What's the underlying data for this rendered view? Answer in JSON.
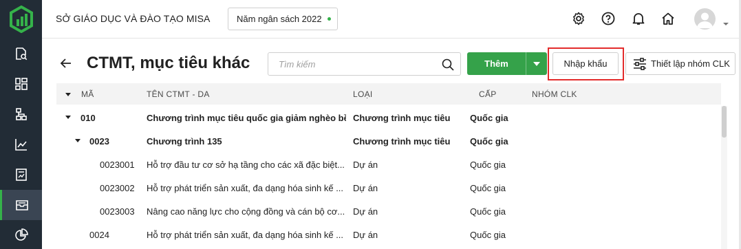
{
  "app": {
    "org_name": "SỞ GIÁO DỤC VÀ ĐÀO TẠO MISA",
    "budget_year": "Năm ngân sách 2022",
    "accent_color": "#35a24a",
    "nav_bg": "#222c36"
  },
  "sidebar": {
    "items": [
      {
        "icon": "doc-search-icon"
      },
      {
        "icon": "dashboard-icon"
      },
      {
        "icon": "org-chart-icon"
      },
      {
        "icon": "line-chart-icon"
      },
      {
        "icon": "report-icon"
      },
      {
        "icon": "inbox-icon",
        "active": true
      },
      {
        "icon": "pie-chart-icon"
      }
    ]
  },
  "topbar": {
    "icons": [
      "gear-icon",
      "help-icon",
      "bell-icon",
      "home-icon",
      "avatar",
      "chevron-down-icon"
    ]
  },
  "page": {
    "title": "CTMT, mục tiêu khác",
    "search_placeholder": "Tìm kiếm",
    "add_label": "Thêm",
    "import_label": "Nhập khẩu",
    "setup_label": "Thiết lập nhóm CLK"
  },
  "table": {
    "columns": [
      "MÃ",
      "TÊN CTMT - DA",
      "LOẠI",
      "CẤP",
      "NHÓM CLK"
    ],
    "rows": [
      {
        "code": "010",
        "name": "Chương trình mục tiêu quốc gia giảm nghèo bề...",
        "type": "Chương trình mục tiêu",
        "level": "Quốc gia",
        "group": "",
        "bold": true,
        "expandable": true,
        "depth": 0
      },
      {
        "code": "0023",
        "name": "Chương trình 135",
        "type": "Chương trình mục tiêu",
        "level": "Quốc gia",
        "group": "",
        "bold": true,
        "expandable": true,
        "depth": 1
      },
      {
        "code": "0023001",
        "name": "Hỗ trợ đầu tư cơ sở hạ tầng cho các xã đặc biệt...",
        "type": "Dự án",
        "level": "Quốc gia",
        "group": "",
        "bold": false,
        "expandable": false,
        "depth": 2
      },
      {
        "code": "0023002",
        "name": "Hỗ trợ phát triển sản xuất, đa dạng hóa sinh kế ...",
        "type": "Dự án",
        "level": "Quốc gia",
        "group": "",
        "bold": false,
        "expandable": false,
        "depth": 2
      },
      {
        "code": "0023003",
        "name": "Nâng cao năng lực cho cộng đồng và cán bộ cơ...",
        "type": "Dự án",
        "level": "Quốc gia",
        "group": "",
        "bold": false,
        "expandable": false,
        "depth": 2
      },
      {
        "code": "0024",
        "name": "Hỗ trợ phát triển sản xuất, đa dạng hóa sinh kế ...",
        "type": "Dự án",
        "level": "Quốc gia",
        "group": "",
        "bold": false,
        "expandable": false,
        "depth": 1
      }
    ]
  }
}
